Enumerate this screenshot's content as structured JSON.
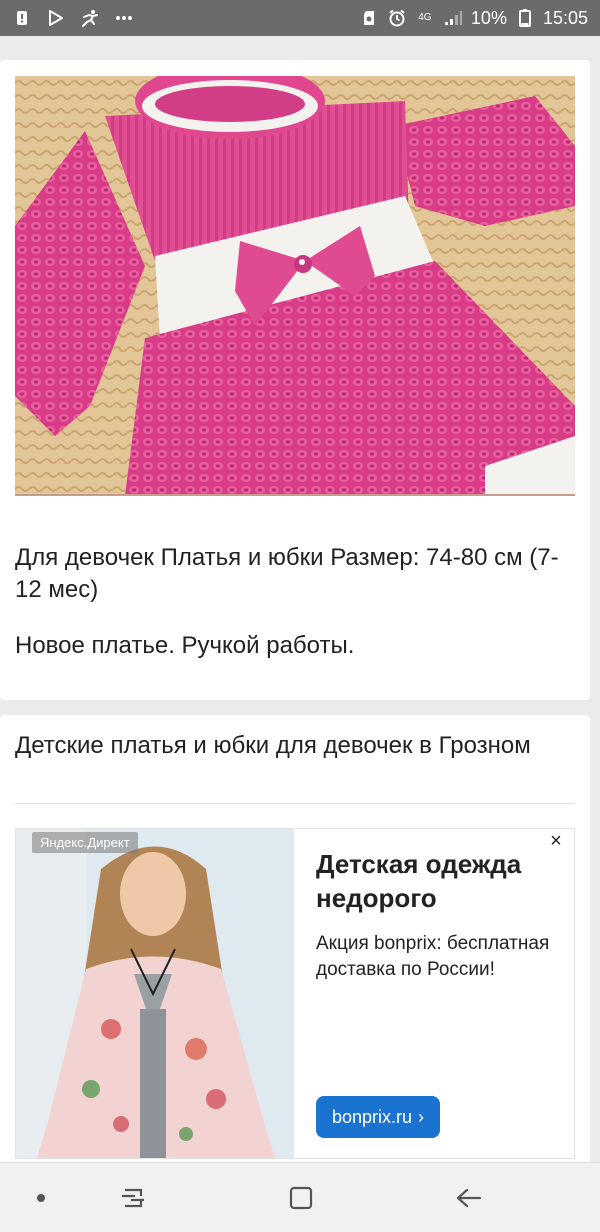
{
  "status_bar": {
    "network": "4G",
    "battery": "10%",
    "time": "15:05",
    "icons": [
      "notification-icon",
      "play-store-icon",
      "running-figure-icon",
      "more-icon",
      "sd-card-icon",
      "alarm-icon",
      "signal-icon",
      "battery-icon"
    ]
  },
  "listing": {
    "photo_alt_subject": "pink knitted dress",
    "description": "Для девочек Платья и юбки Размер: 74-80 см (7-12 мес)",
    "note": "Новое платье. Ручкой работы."
  },
  "related": {
    "title": "Детские платья и юбки для девочек в Грозном"
  },
  "ad": {
    "label": "Яндекс.Директ",
    "close": "×",
    "headline": "Детская одежда недорого",
    "body": "Акция bonprix: бесплатная доставка по России!",
    "button": "bonprix.ru",
    "button_arrow": "›"
  },
  "navbar": {
    "icons": [
      "dot-icon",
      "recent-apps-icon",
      "home-icon",
      "back-icon"
    ]
  },
  "colors": {
    "status_bar": "#6b6b6b",
    "ad_button": "#1a73d0",
    "dress_pink": "#e0478f",
    "dress_white": "#f4f2ee"
  }
}
